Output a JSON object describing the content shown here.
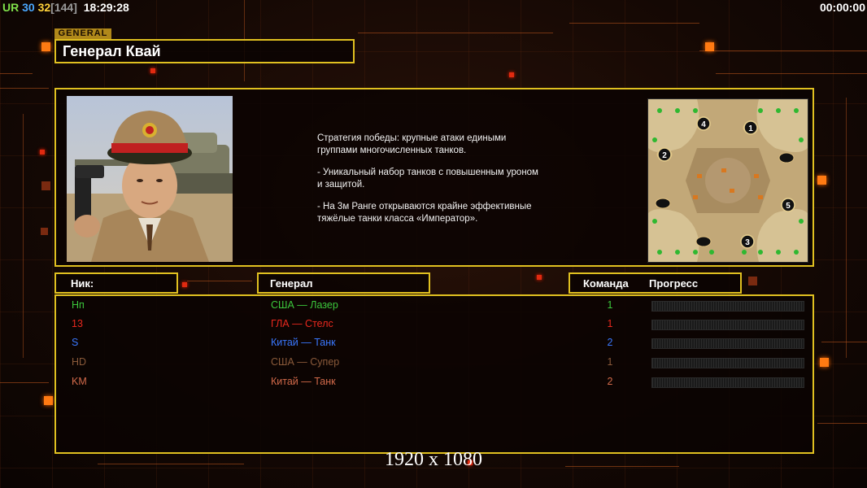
{
  "hud": {
    "ur": "UR",
    "val_a": "30",
    "val_b": "32",
    "val_c": "[144]",
    "clock": "18:29:28",
    "timer": "00:00:00"
  },
  "general_tag": "GENERAL",
  "general_name": "Генерал Квай",
  "description": [
    "Стратегия победы: крупные атаки едиными\n группами многочисленных танков.",
    "- Уникальный набор танков с повышенным уроном\n и защитой.",
    "- На 3м Ранге открываются крайне эффективные\n тяжёлые танки класса «Император»."
  ],
  "minimap_spawns": [
    "1",
    "2",
    "3",
    "4",
    "5"
  ],
  "headers": {
    "nick": "Ник:",
    "general": "Генерал",
    "team": "Команда",
    "progress": "Прогресс"
  },
  "players": [
    {
      "nick": "Hп",
      "general": "США — Лазер",
      "team": "1",
      "progress": 0,
      "nick_color": "#3cc83c",
      "gen_color": "#3cc83c",
      "team_color": "#3cc83c"
    },
    {
      "nick": "13",
      "general": "ГЛА — Стелс",
      "team": "1",
      "progress": 0,
      "nick_color": "#e8281e",
      "gen_color": "#e8281e",
      "team_color": "#e8281e"
    },
    {
      "nick": "S",
      "general": "Китай — Танк",
      "team": "2",
      "progress": 0,
      "nick_color": "#3a78ff",
      "gen_color": "#3a78ff",
      "team_color": "#3a78ff"
    },
    {
      "nick": "HD",
      "general": "США — Супер",
      "team": "1",
      "progress": 0,
      "nick_color": "#8a5a3a",
      "gen_color": "#8a5a3a",
      "team_color": "#8a5a3a"
    },
    {
      "nick": "KM",
      "general": "Китай — Танк",
      "team": "2",
      "progress": 0,
      "nick_color": "#d26a4a",
      "gen_color": "#d26a4a",
      "team_color": "#d26a4a"
    }
  ],
  "resolution_label": "1920 x 1080",
  "colors": {
    "frame": "#e0c020",
    "accent": "#ff7a12",
    "background": "#0d0603"
  }
}
